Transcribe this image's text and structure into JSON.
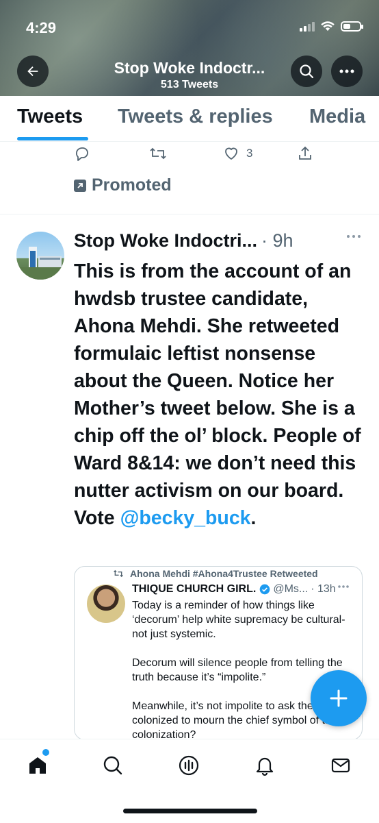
{
  "status": {
    "time": "4:29"
  },
  "header": {
    "title": "Stop Woke Indoctr...",
    "tweet_count": "513 Tweets"
  },
  "tabs": [
    {
      "label": "Tweets",
      "active": true
    },
    {
      "label": "Tweets & replies",
      "active": false
    },
    {
      "label": "Media",
      "active": false
    }
  ],
  "prior_tweet": {
    "like_count": "3",
    "promoted_label": "Promoted"
  },
  "tweet": {
    "author": "Stop Woke Indoctri...",
    "time": "· 9h",
    "body": "This is from the account of an hwdsb trustee candidate, Ahona Mehdi. She retweeted formulaic leftist nonsense about the Queen. Notice her Mother’s tweet below. She is a chip off the ol’ block. People of Ward 8&14: we don’t need this nutter activism on our board. Vote ",
    "mention": "@becky_buck",
    "body_end": "."
  },
  "quote": {
    "retweeted_by": "Ahona Mehdi #Ahona4Trustee Retweeted",
    "author": "THIQUE CHURCH GIRL.",
    "handle": "@Ms...",
    "time": "· 13h",
    "paragraphs": [
      "Today is a reminder of how things like ‘decorum’ help white supremacy be cultural-not just systemic.",
      "Decorum will silence people from telling the truth because it’s “impolite.”",
      "Meanwhile, it’s not impolite to ask the colonized to mourn the chief symbol of their colonization?"
    ]
  },
  "colors": {
    "accent": "#1d9bf0",
    "text": "#0f1419",
    "secondary": "#536471"
  },
  "icons": [
    "back-arrow-icon",
    "search-icon",
    "more-icon",
    "reply-icon",
    "retweet-icon",
    "like-icon",
    "share-icon",
    "promoted-icon",
    "verified-icon",
    "compose-icon",
    "home-icon",
    "explore-icon",
    "spaces-icon",
    "notifications-icon",
    "messages-icon"
  ]
}
